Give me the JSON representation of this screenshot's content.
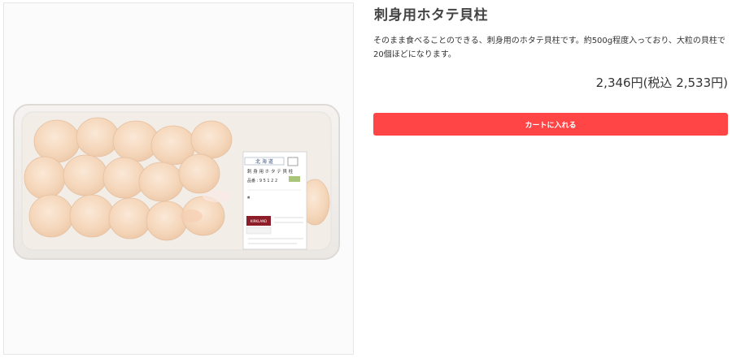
{
  "product": {
    "title": "刺身用ホタテ貝柱",
    "description": "そのまま食べることのできる、刺身用のホタテ貝柱です。約500g程度入っており、大粒の貝柱で20個ほどになります。",
    "price": "2,346円(税込 2,533円)",
    "image": {
      "label_region": "北 海 道",
      "label_name": "刺 身 用 ホ タ テ 貝 柱",
      "label_code": "品番 : 9 5 1 2 2",
      "brand": "KIRKLAND"
    }
  },
  "actions": {
    "add_to_cart_label": "カートに入れる"
  },
  "colors": {
    "cart_button": "#ff4545",
    "scallop": "#f6d4b6"
  }
}
